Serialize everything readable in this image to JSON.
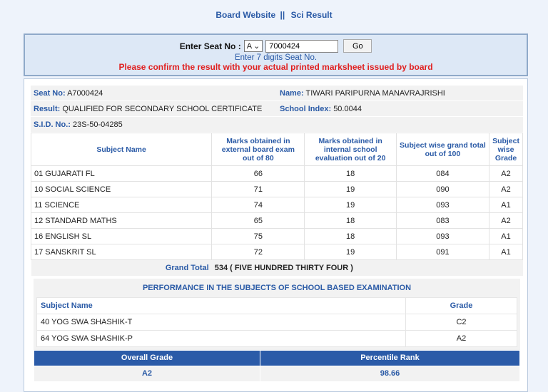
{
  "top_links": {
    "board_website": "Board Website",
    "separator": "||",
    "sci_result": "Sci Result"
  },
  "search": {
    "label": "Enter Seat No :",
    "series": "A",
    "seat_value": "7000424",
    "go": "Go",
    "hint": "Enter 7 digits Seat No.",
    "warning": "Please confirm the result with your actual printed marksheet issued by board"
  },
  "student": {
    "seat_label": "Seat No:",
    "seat": "A7000424",
    "name_label": "Name:",
    "name": "TIWARI PARIPURNA MANAVRAJRISHI",
    "result_label": "Result:",
    "result": "QUALIFIED FOR SECONDARY SCHOOL CERTIFICATE",
    "school_label": "School Index:",
    "school": "50.0044",
    "sid_label": "S.I.D. No.:",
    "sid": "23S-50-04285"
  },
  "marks": {
    "headers": [
      "Subject Name",
      "Marks obtained in external board exam out of 80",
      "Marks obtained in internal school evaluation out of 20",
      "Subject wise grand total out of 100",
      "Subject wise Grade"
    ],
    "rows": [
      [
        "01 GUJARATI FL",
        "66",
        "18",
        "084",
        "A2"
      ],
      [
        "10 SOCIAL SCIENCE",
        "71",
        "19",
        "090",
        "A2"
      ],
      [
        "11 SCIENCE",
        "74",
        "19",
        "093",
        "A1"
      ],
      [
        "12 STANDARD MATHS",
        "65",
        "18",
        "083",
        "A2"
      ],
      [
        "16 ENGLISH SL",
        "75",
        "18",
        "093",
        "A1"
      ],
      [
        "17 SANSKRIT SL",
        "72",
        "19",
        "091",
        "A1"
      ]
    ],
    "grand_total_label": "Grand Total",
    "grand_total": "534 ( FIVE HUNDRED THIRTY FOUR )"
  },
  "school_based": {
    "title": "PERFORMANCE IN THE SUBJECTS OF SCHOOL BASED EXAMINATION",
    "headers": [
      "Subject Name",
      "Grade"
    ],
    "rows": [
      [
        "40 YOG SWA SHASHIK-T",
        "C2"
      ],
      [
        "64 YOG SWA SHASHIK-P",
        "A2"
      ]
    ]
  },
  "overall": {
    "grade_label": "Overall Grade",
    "rank_label": "Percentile Rank",
    "grade": "A2",
    "rank": "98.66"
  }
}
